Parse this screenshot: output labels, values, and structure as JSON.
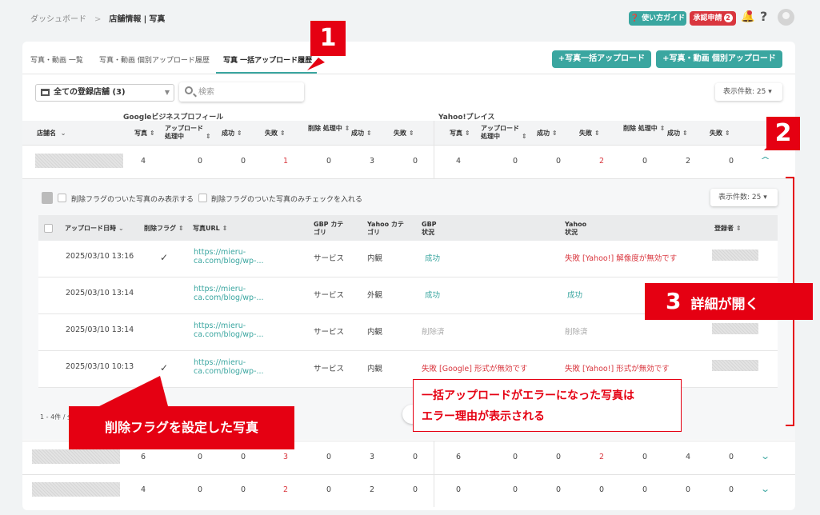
{
  "breadcrumb": {
    "root": "ダッシュボード",
    "sep": ">",
    "parent": "店舗情報",
    "divider": "|",
    "current": "写真"
  },
  "header": {
    "guide_label": "使い方ガイド",
    "approval_label": "承認申請",
    "approval_count": "2",
    "help": "?"
  },
  "tabs": [
    {
      "label": "写真・動画 一覧"
    },
    {
      "label": "写真・動画 個別アップロード履歴"
    },
    {
      "label": "写真 一括アップロード履歴",
      "active": true
    }
  ],
  "actions": {
    "bulk_upload": "+写真一括アップロード",
    "single_upload": "+写真・動画 個別アップロード"
  },
  "filters": {
    "store_select": "全ての登録店舗 (3)",
    "search_placeholder": "検索",
    "per_page": "表示件数: 25 ▾"
  },
  "main_table": {
    "groups": {
      "google": "Googleビジネスプロフィール",
      "yahoo": "Yahoo!プレイス"
    },
    "headers": {
      "store": "店舗名",
      "google": [
        {
          "label": "写真"
        },
        {
          "label": "アップロード 処理中"
        },
        {
          "label": "成功"
        },
        {
          "label": "失敗"
        },
        {
          "label": "削除 処理中"
        },
        {
          "label": "成功"
        },
        {
          "label": "失敗"
        }
      ],
      "yahoo": [
        {
          "label": "写真"
        },
        {
          "label": "アップロード 処理中"
        },
        {
          "label": "成功"
        },
        {
          "label": "失敗"
        },
        {
          "label": "削除 処理中"
        },
        {
          "label": "成功"
        },
        {
          "label": "失敗"
        }
      ]
    },
    "rows": [
      {
        "google": [
          "4",
          "0",
          "0",
          "1",
          "0",
          "3",
          "0"
        ],
        "yahoo": [
          "4",
          "0",
          "0",
          "2",
          "0",
          "2",
          "0"
        ],
        "expanded": true
      },
      {
        "google": [
          "6",
          "0",
          "0",
          "3",
          "0",
          "3",
          "0"
        ],
        "yahoo": [
          "6",
          "0",
          "0",
          "2",
          "0",
          "4",
          "0"
        ],
        "expanded": false
      },
      {
        "google": [
          "4",
          "0",
          "0",
          "2",
          "0",
          "2",
          "0"
        ],
        "yahoo": [
          "0",
          "0",
          "0",
          "0",
          "0",
          "0",
          "0"
        ],
        "expanded": false
      }
    ]
  },
  "detail": {
    "flag_filter_show": "削除フラグのついた写真のみ表示する",
    "flag_filter_check": "削除フラグのついた写真のみチェックを入れる",
    "per_page": "表示件数: 25 ▾",
    "headers": {
      "uploaded_at": "アップロード日時",
      "delete_flag": "削除フラグ",
      "url": "写真URL",
      "gbp_category": "GBP カテゴリ",
      "yahoo_category": "Yahoo カテゴリ",
      "gbp_status": "GBP 状況",
      "yahoo_status": "Yahoo 状況",
      "registrant": "登録者"
    },
    "rows": [
      {
        "date": "2025/03/10 13:16",
        "flag": "✓",
        "url1": "https://mieru-",
        "url2": "ca.com/blog/wp-...",
        "gbp_cat": "サービス",
        "yahoo_cat": "内観",
        "gbp_status": "成功",
        "gbp_type": "ok",
        "yahoo_status": "失敗 [Yahoo!] 解像度が無効です",
        "yahoo_type": "err"
      },
      {
        "date": "2025/03/10 13:14",
        "flag": "",
        "url1": "https://mieru-",
        "url2": "ca.com/blog/wp-...",
        "gbp_cat": "サービス",
        "yahoo_cat": "外観",
        "gbp_status": "成功",
        "gbp_type": "ok",
        "yahoo_status": "成功",
        "yahoo_type": "ok"
      },
      {
        "date": "2025/03/10 13:14",
        "flag": "",
        "url1": "https://mieru-",
        "url2": "ca.com/blog/wp-...",
        "gbp_cat": "サービス",
        "yahoo_cat": "内観",
        "gbp_status": "削除済",
        "gbp_type": "gray",
        "yahoo_status": "削除済",
        "yahoo_type": "gray"
      },
      {
        "date": "2025/03/10 10:13",
        "flag": "✓",
        "url1": "https://mieru-",
        "url2": "ca.com/blog/wp-...",
        "gbp_cat": "サービス",
        "yahoo_cat": "内観",
        "gbp_status": "失敗 [Google] 形式が無効です",
        "gbp_type": "err",
        "yahoo_status": "失敗 [Yahoo!] 形式が無効です",
        "yahoo_type": "err"
      }
    ],
    "pagination": "1 - 4件 / 全"
  },
  "annotations": {
    "n1": "1",
    "n2": "2",
    "n3": "3",
    "detail_open": "詳細が開く",
    "error_note_1": "一括アップロードがエラーになった写真は",
    "error_note_2": "エラー理由が表示される",
    "flag_note": "削除フラグを設定した写真"
  },
  "colors": {
    "accent": "#3aa6a0",
    "error": "#d9363e",
    "annotation": "#e50012"
  }
}
